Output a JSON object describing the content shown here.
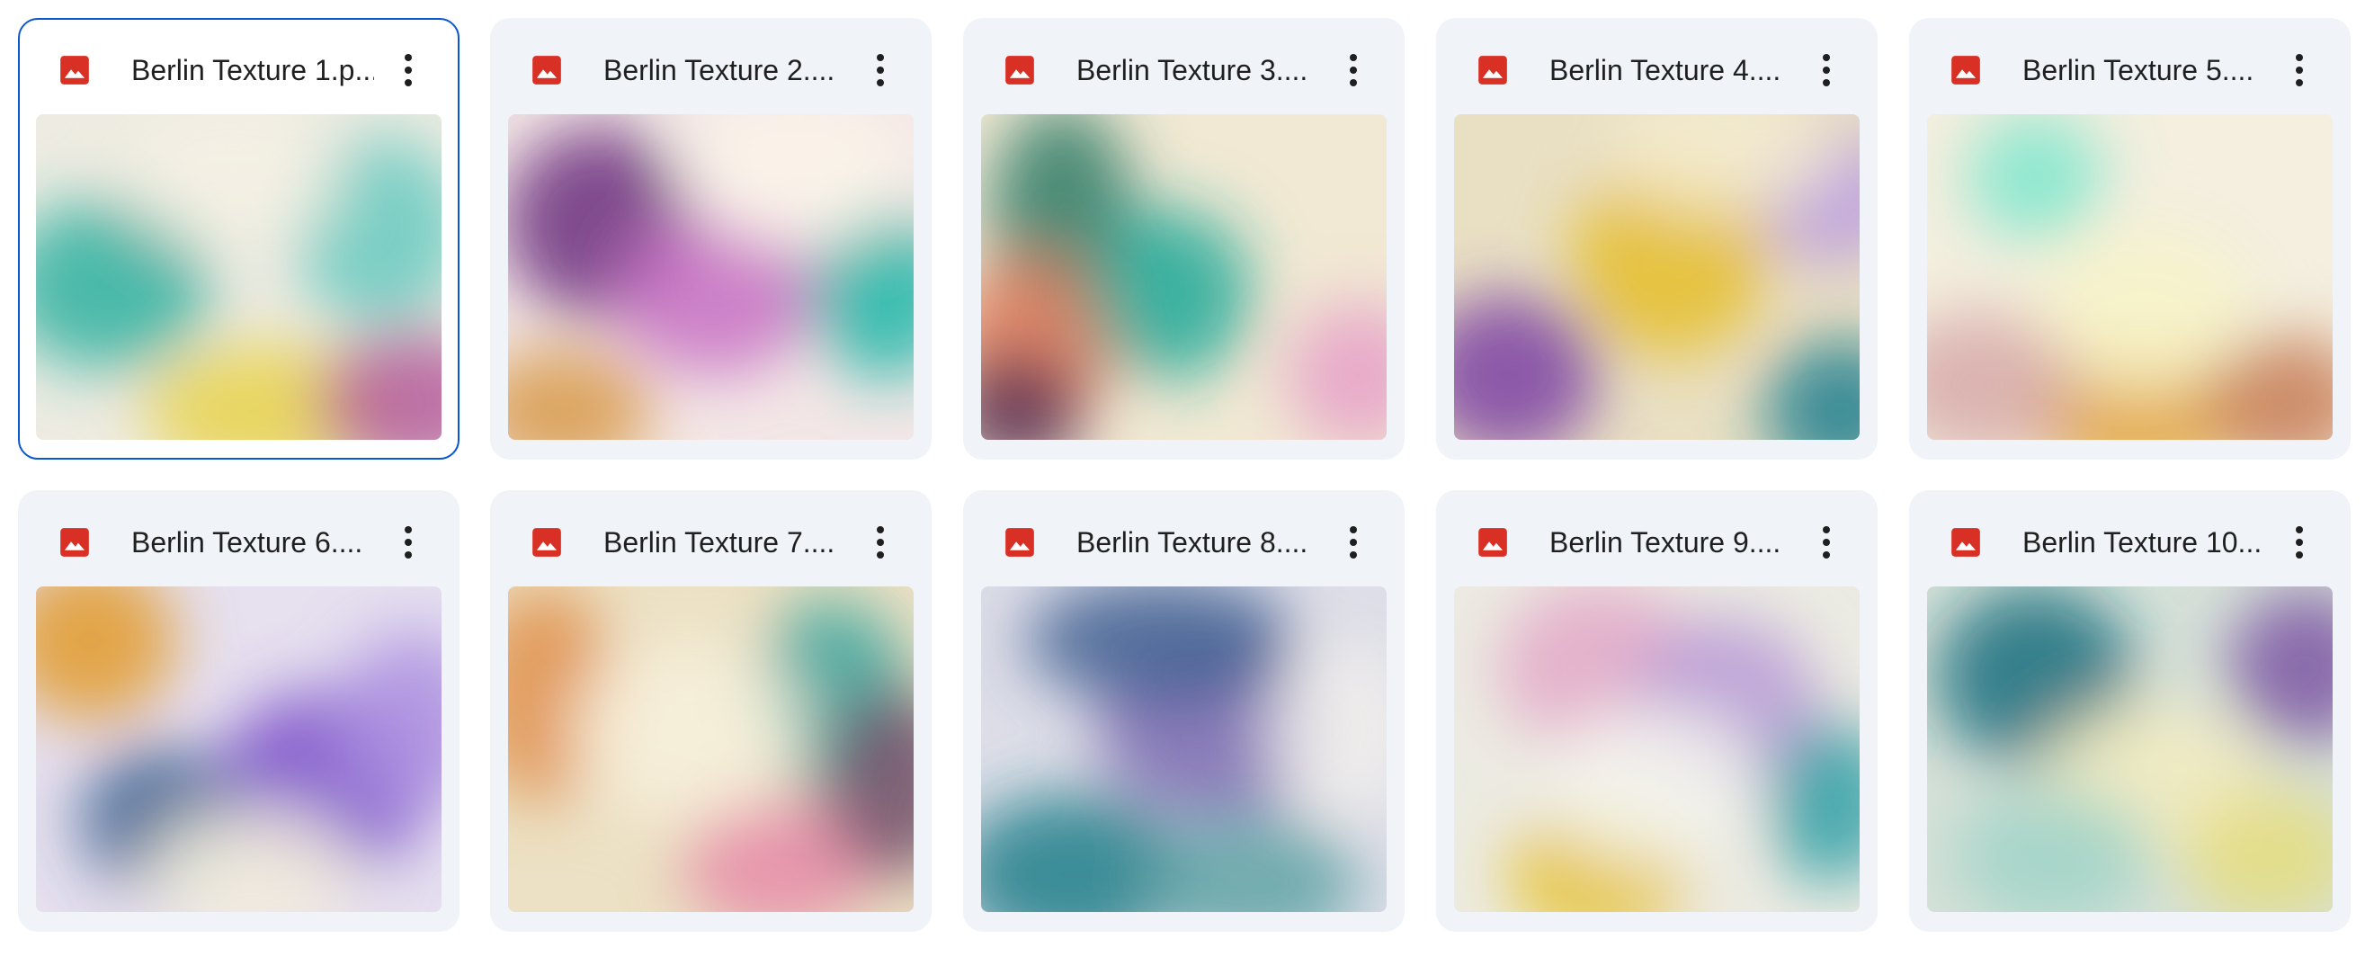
{
  "colors": {
    "card_background": "#f0f4f9",
    "selected_border": "#0b57d0",
    "image_icon_red": "#d93025",
    "text": "#1f1f1f"
  },
  "files": [
    {
      "name": "Berlin Texture 1.p...",
      "icon": "image-icon",
      "selected": true,
      "palette": {
        "base": "#eeece2",
        "blobs": [
          "#2fb0a0",
          "#66c9c0",
          "#e7d24a",
          "#b45c9c",
          "#f4f0e4"
        ]
      }
    },
    {
      "name": "Berlin Texture 2....",
      "icon": "image-icon",
      "selected": false,
      "palette": {
        "base": "#f3e7e6",
        "blobs": [
          "#6b2d7e",
          "#c770c3",
          "#1fb6a8",
          "#d89a4a",
          "#fbf4ea"
        ]
      }
    },
    {
      "name": "Berlin Texture 3....",
      "icon": "image-icon",
      "selected": false,
      "palette": {
        "base": "#f1e9d4",
        "blobs": [
          "#2f7b66",
          "#e07b5a",
          "#21a896",
          "#e6a0c8",
          "#5a2f52"
        ]
      }
    },
    {
      "name": "Berlin Texture 4....",
      "icon": "image-icon",
      "selected": false,
      "palette": {
        "base": "#e9e0c4",
        "blobs": [
          "#e5bd2b",
          "#7b3fa3",
          "#1d7f8f",
          "#b89ae0",
          "#f4ecd0"
        ]
      }
    },
    {
      "name": "Berlin Texture 5....",
      "icon": "image-icon",
      "selected": false,
      "palette": {
        "base": "#f4efdf",
        "blobs": [
          "#e0a02b",
          "#7de6cc",
          "#f7f3c8",
          "#d6a9a9",
          "#c77d56"
        ]
      }
    },
    {
      "name": "Berlin Texture 6....",
      "icon": "image-icon",
      "selected": false,
      "palette": {
        "base": "#e6e0ef",
        "blobs": [
          "#e29a2b",
          "#7b4fc9",
          "#355e8c",
          "#ad8fe0",
          "#f4efdc"
        ]
      }
    },
    {
      "name": "Berlin Texture 7....",
      "icon": "image-icon",
      "selected": false,
      "palette": {
        "base": "#ece1c4",
        "blobs": [
          "#e08f4a",
          "#3aa49d",
          "#e68aa8",
          "#6e4e6a",
          "#f7f0dc"
        ]
      }
    },
    {
      "name": "Berlin Texture 8....",
      "icon": "image-icon",
      "selected": false,
      "palette": {
        "base": "#dedee8",
        "blobs": [
          "#7b6bb0",
          "#1f7f8a",
          "#5fa3a6",
          "#f2f0ec",
          "#3f5f90"
        ]
      }
    },
    {
      "name": "Berlin Texture 9....",
      "icon": "image-icon",
      "selected": false,
      "palette": {
        "base": "#ecebe2",
        "blobs": [
          "#e3a8c8",
          "#e6c22b",
          "#b79ad6",
          "#2f9fa6",
          "#f5f4ee"
        ]
      }
    },
    {
      "name": "Berlin Texture 10...",
      "icon": "image-icon",
      "selected": false,
      "palette": {
        "base": "#d6e1d8",
        "blobs": [
          "#146f7e",
          "#f3ecc0",
          "#7c55a3",
          "#9fd4c8",
          "#e5dd7e"
        ]
      }
    }
  ]
}
